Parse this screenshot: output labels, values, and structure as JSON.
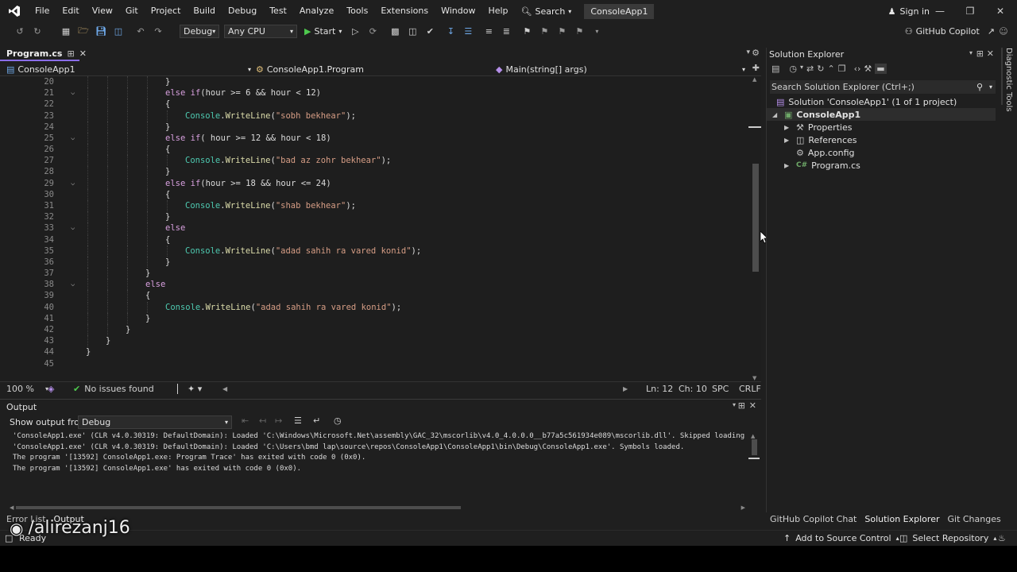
{
  "menubar": {
    "items": [
      "File",
      "Edit",
      "View",
      "Git",
      "Project",
      "Build",
      "Debug",
      "Test",
      "Analyze",
      "Tools",
      "Extensions",
      "Window",
      "Help"
    ],
    "search_label": "Search",
    "solution_name": "ConsoleApp1",
    "signin_label": "Sign in"
  },
  "toolbar": {
    "config": "Debug",
    "platform": "Any CPU",
    "start_label": "Start",
    "copilot_label": "GitHub Copilot"
  },
  "editor": {
    "tab_label": "Program.cs",
    "nav_project": "ConsoleApp1",
    "nav_class": "ConsoleApp1.Program",
    "nav_member": "Main(string[] args)",
    "zoom": "100 %",
    "issues": "No issues found",
    "ln": "Ln: 12",
    "ch": "Ch: 10",
    "spc": "SPC",
    "eol": "CRLF",
    "lines": [
      {
        "n": "20",
        "fold": false,
        "indent": 4,
        "tokens": [
          {
            "c": "plain",
            "t": "}"
          }
        ]
      },
      {
        "n": "21",
        "fold": true,
        "indent": 4,
        "tokens": [
          {
            "c": "kw",
            "t": "else"
          },
          {
            "c": "plain",
            "t": " "
          },
          {
            "c": "kw",
            "t": "if"
          },
          {
            "c": "plain",
            "t": "(hour >= 6 && hour < 12)"
          }
        ]
      },
      {
        "n": "22",
        "fold": false,
        "indent": 4,
        "tokens": [
          {
            "c": "plain",
            "t": "{"
          }
        ]
      },
      {
        "n": "23",
        "fold": false,
        "indent": 5,
        "tokens": [
          {
            "c": "cls",
            "t": "Console"
          },
          {
            "c": "plain",
            "t": "."
          },
          {
            "c": "meth",
            "t": "WriteLine"
          },
          {
            "c": "plain",
            "t": "("
          },
          {
            "c": "str",
            "t": "\"sobh bekhear\""
          },
          {
            "c": "plain",
            "t": ");"
          }
        ]
      },
      {
        "n": "24",
        "fold": false,
        "indent": 4,
        "tokens": [
          {
            "c": "plain",
            "t": "}"
          }
        ]
      },
      {
        "n": "25",
        "fold": true,
        "indent": 4,
        "tokens": [
          {
            "c": "kw",
            "t": "else"
          },
          {
            "c": "plain",
            "t": " "
          },
          {
            "c": "kw",
            "t": "if"
          },
          {
            "c": "plain",
            "t": "( hour >= 12 && hour < 18)"
          }
        ]
      },
      {
        "n": "26",
        "fold": false,
        "indent": 4,
        "tokens": [
          {
            "c": "plain",
            "t": "{"
          }
        ]
      },
      {
        "n": "27",
        "fold": false,
        "indent": 5,
        "tokens": [
          {
            "c": "cls",
            "t": "Console"
          },
          {
            "c": "plain",
            "t": "."
          },
          {
            "c": "meth",
            "t": "WriteLine"
          },
          {
            "c": "plain",
            "t": "("
          },
          {
            "c": "str",
            "t": "\"bad az zohr bekhear\""
          },
          {
            "c": "plain",
            "t": ");"
          }
        ]
      },
      {
        "n": "28",
        "fold": false,
        "indent": 4,
        "tokens": [
          {
            "c": "plain",
            "t": "}"
          }
        ]
      },
      {
        "n": "29",
        "fold": true,
        "indent": 4,
        "tokens": [
          {
            "c": "kw",
            "t": "else"
          },
          {
            "c": "plain",
            "t": " "
          },
          {
            "c": "kw",
            "t": "if"
          },
          {
            "c": "plain",
            "t": "(hour >= 18 && hour <= 24)"
          }
        ]
      },
      {
        "n": "30",
        "fold": false,
        "indent": 4,
        "tokens": [
          {
            "c": "plain",
            "t": "{"
          }
        ]
      },
      {
        "n": "31",
        "fold": false,
        "indent": 5,
        "tokens": [
          {
            "c": "cls",
            "t": "Console"
          },
          {
            "c": "plain",
            "t": "."
          },
          {
            "c": "meth",
            "t": "WriteLine"
          },
          {
            "c": "plain",
            "t": "("
          },
          {
            "c": "str",
            "t": "\"shab bekhear\""
          },
          {
            "c": "plain",
            "t": ");"
          }
        ]
      },
      {
        "n": "32",
        "fold": false,
        "indent": 4,
        "tokens": [
          {
            "c": "plain",
            "t": "}"
          }
        ]
      },
      {
        "n": "33",
        "fold": true,
        "indent": 4,
        "tokens": [
          {
            "c": "kw",
            "t": "else"
          }
        ]
      },
      {
        "n": "34",
        "fold": false,
        "indent": 4,
        "tokens": [
          {
            "c": "plain",
            "t": "{"
          }
        ]
      },
      {
        "n": "35",
        "fold": false,
        "indent": 5,
        "tokens": [
          {
            "c": "cls",
            "t": "Console"
          },
          {
            "c": "plain",
            "t": "."
          },
          {
            "c": "meth",
            "t": "WriteLine"
          },
          {
            "c": "plain",
            "t": "("
          },
          {
            "c": "str",
            "t": "\"adad sahih ra vared konid\""
          },
          {
            "c": "plain",
            "t": ");"
          }
        ]
      },
      {
        "n": "36",
        "fold": false,
        "indent": 4,
        "tokens": [
          {
            "c": "plain",
            "t": "}"
          }
        ]
      },
      {
        "n": "37",
        "fold": false,
        "indent": 3,
        "tokens": [
          {
            "c": "plain",
            "t": "}"
          }
        ]
      },
      {
        "n": "38",
        "fold": true,
        "indent": 3,
        "tokens": [
          {
            "c": "kw",
            "t": "else"
          }
        ]
      },
      {
        "n": "39",
        "fold": false,
        "indent": 3,
        "tokens": [
          {
            "c": "plain",
            "t": "{"
          }
        ]
      },
      {
        "n": "40",
        "fold": false,
        "indent": 4,
        "tokens": [
          {
            "c": "cls",
            "t": "Console"
          },
          {
            "c": "plain",
            "t": "."
          },
          {
            "c": "meth",
            "t": "WriteLine"
          },
          {
            "c": "plain",
            "t": "("
          },
          {
            "c": "str",
            "t": "\"adad sahih ra vared konid\""
          },
          {
            "c": "plain",
            "t": ");"
          }
        ]
      },
      {
        "n": "41",
        "fold": false,
        "indent": 3,
        "tokens": [
          {
            "c": "plain",
            "t": "}"
          }
        ]
      },
      {
        "n": "42",
        "fold": false,
        "indent": 2,
        "tokens": [
          {
            "c": "plain",
            "t": "}"
          }
        ]
      },
      {
        "n": "43",
        "fold": false,
        "indent": 1,
        "tokens": [
          {
            "c": "plain",
            "t": "}"
          }
        ]
      },
      {
        "n": "44",
        "fold": false,
        "indent": 0,
        "tokens": [
          {
            "c": "plain",
            "t": "}"
          }
        ]
      },
      {
        "n": "45",
        "fold": false,
        "indent": 0,
        "tokens": []
      }
    ]
  },
  "output": {
    "title": "Output",
    "show_from_label": "Show output from:",
    "source": "Debug",
    "lines": [
      "'ConsoleApp1.exe' (CLR v4.0.30319: DefaultDomain): Loaded 'C:\\Windows\\Microsoft.Net\\assembly\\GAC_32\\mscorlib\\v4.0_4.0.0.0__b77a5c561934e089\\mscorlib.dll'. Skipped loading sym",
      "'ConsoleApp1.exe' (CLR v4.0.30319: DefaultDomain): Loaded 'C:\\Users\\bmd lap\\source\\repos\\ConsoleApp1\\ConsoleApp1\\bin\\Debug\\ConsoleApp1.exe'. Symbols loaded.",
      "The program '[13592] ConsoleApp1.exe: Program Trace' has exited with code 0 (0x0).",
      "The program '[13592] ConsoleApp1.exe' has exited with code 0 (0x0)."
    ],
    "bottom_tabs": [
      "Error List",
      "Output"
    ]
  },
  "solution_explorer": {
    "title": "Solution Explorer",
    "search_placeholder": "Search Solution Explorer (Ctrl+;)",
    "solution": "Solution 'ConsoleApp1' (1 of 1 project)",
    "project": "ConsoleApp1",
    "items": [
      "Properties",
      "References",
      "App.config",
      "Program.cs"
    ]
  },
  "side_strip": {
    "label": "Diagnostic Tools"
  },
  "right_bottom_tabs": [
    "GitHub Copilot Chat",
    "Solution Explorer",
    "Git Changes"
  ],
  "statusbar": {
    "ready": "Ready",
    "source_control": "Add to Source Control",
    "repository": "Select Repository"
  },
  "watermark": "/alirezanj16",
  "colors": {
    "accent": "#8a6de8",
    "keyword": "#d8a0df",
    "class": "#4ec9b0",
    "method": "#dcdcaa",
    "string": "#d69d85"
  }
}
